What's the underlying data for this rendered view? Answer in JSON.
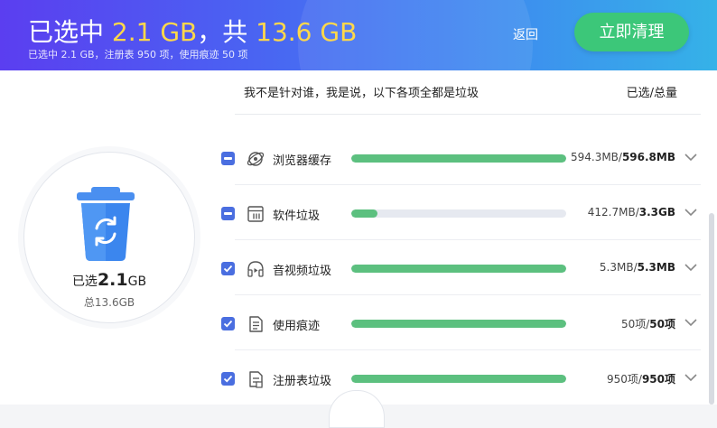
{
  "header": {
    "title_prefix": "已选中 ",
    "title_selected": "2.1 GB",
    "title_mid": "，共 ",
    "title_total": "13.6 GB",
    "subtitle": "已选中 2.1 GB，注册表 950 项，使用痕迹 50 项",
    "back_label": "返回",
    "clean_label": "立即清理",
    "highlight_color": "#ffd84a",
    "button_color": "#3cc779"
  },
  "summary": {
    "selected_label": "已选",
    "selected_value": "2.1",
    "selected_unit": "GB",
    "total_label": "总13.6GB"
  },
  "list": {
    "head_note": "我不是针对谁，我是说，以下各项全都是垃圾",
    "head_right": "已选/总量",
    "items": [
      {
        "name": "浏览器缓存",
        "selected": "594.3MB/",
        "total": "596.8MB",
        "fill": 1.0,
        "state": "partial",
        "icon": "browser-cache-icon"
      },
      {
        "name": "软件垃圾",
        "selected": "412.7MB/",
        "total": "3.3GB",
        "fill": 0.12,
        "state": "partial",
        "icon": "software-junk-icon"
      },
      {
        "name": "音视频垃圾",
        "selected": "5.3MB/",
        "total": "5.3MB",
        "fill": 1.0,
        "state": "checked",
        "icon": "media-junk-icon"
      },
      {
        "name": "使用痕迹",
        "selected": "50项/",
        "total": "50项",
        "fill": 1.0,
        "state": "checked",
        "icon": "usage-trace-icon"
      },
      {
        "name": "注册表垃圾",
        "selected": "950项/",
        "total": "950项",
        "fill": 1.0,
        "state": "checked",
        "icon": "registry-junk-icon"
      }
    ]
  }
}
